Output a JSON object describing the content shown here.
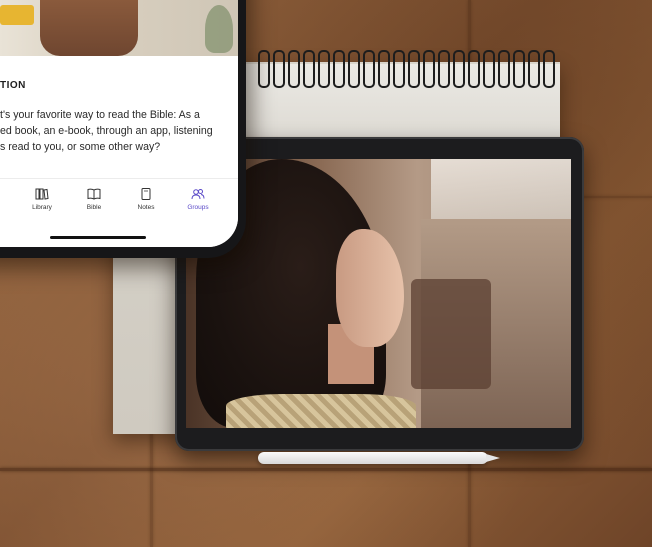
{
  "phone": {
    "section_label": "TION",
    "question_lines": [
      "t's your favorite way to read the Bible: As a",
      "ed book, an e-book, through an app, listening",
      "s read to you, or some other way?"
    ],
    "tabs": [
      {
        "label": "Library",
        "icon": "library-icon",
        "active": false
      },
      {
        "label": "Bible",
        "icon": "open-book-icon",
        "active": false
      },
      {
        "label": "Notes",
        "icon": "notes-icon",
        "active": false
      },
      {
        "label": "Groups",
        "icon": "groups-icon",
        "active": true
      }
    ],
    "accent_color": "#5a49c8"
  }
}
